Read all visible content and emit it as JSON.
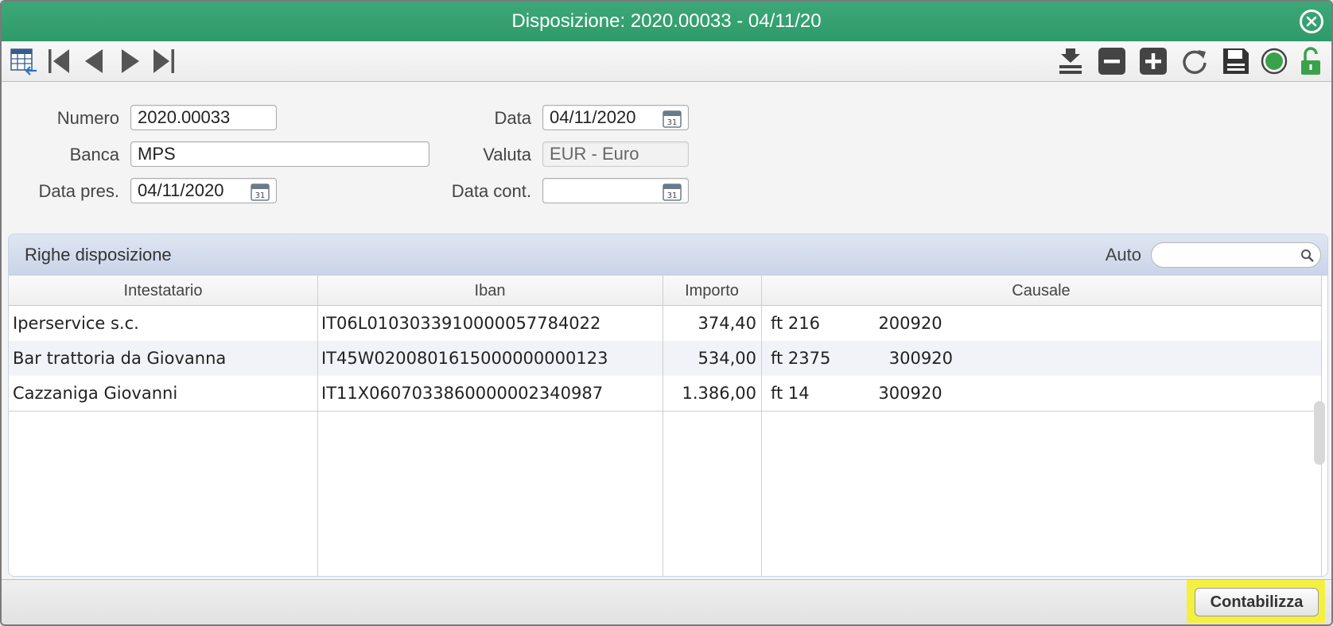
{
  "window": {
    "title": "Disposizione: 2020.00033 - 04/11/20",
    "accent_color": "#35a06f"
  },
  "form": {
    "numero_label": "Numero",
    "numero_value": "2020.00033",
    "banca_label": "Banca",
    "banca_value": "MPS",
    "data_pres_label": "Data pres.",
    "data_pres_value": "04/11/2020",
    "data_label": "Data",
    "data_value": "04/11/2020",
    "valuta_label": "Valuta",
    "valuta_value": "EUR - Euro",
    "data_cont_label": "Data cont.",
    "data_cont_value": ""
  },
  "grid": {
    "title": "Righe disposizione",
    "auto_label": "Auto",
    "search_value": "",
    "columns": [
      "Intestatario",
      "Iban",
      "Importo",
      "Causale"
    ],
    "rows": [
      {
        "intestatario": "Iperservice s.c.",
        "iban": "IT06L0103033910000057784022",
        "importo": "374,40",
        "causale": "ft 216           200920"
      },
      {
        "intestatario": "Bar trattoria da Giovanna",
        "iban": "IT45W0200801615000000000123",
        "importo": "534,00",
        "causale": "ft 2375           300920"
      },
      {
        "intestatario": "Cazzaniga Giovanni",
        "iban": "IT11X0607033860000002340987",
        "importo": "1.386,00",
        "causale": "ft 14             300920"
      }
    ]
  },
  "footer": {
    "contabilizza_label": "Contabilizza",
    "highlight_color": "#f4f040"
  },
  "icons": [
    "grid-back-icon",
    "first-record-icon",
    "prev-record-icon",
    "next-record-icon",
    "last-record-icon",
    "download-icon",
    "delete-icon",
    "add-icon",
    "refresh-icon",
    "save-icon",
    "status-dot-icon",
    "unlocked-icon",
    "calendar-icon",
    "search-icon",
    "close-icon"
  ]
}
